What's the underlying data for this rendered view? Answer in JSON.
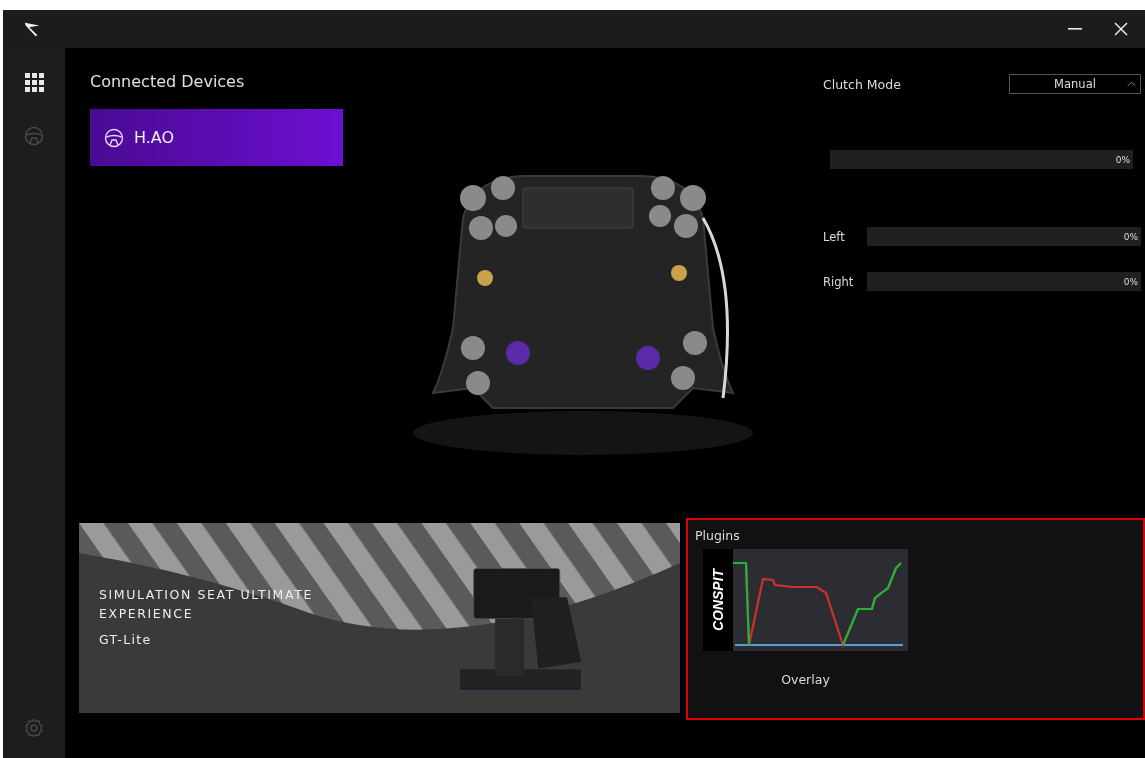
{
  "window": {
    "controls": [
      {
        "kind": "minimize"
      },
      {
        "kind": "close"
      }
    ]
  },
  "sidebar": {
    "items": [
      {
        "kind": "grid",
        "selected": true
      },
      {
        "kind": "wheel",
        "selected": false
      }
    ],
    "footer": {
      "kind": "settings"
    }
  },
  "devices": {
    "title": "Connected Devices",
    "items": [
      {
        "name": "H.AO",
        "selected": true
      }
    ]
  },
  "settings": {
    "clutch_mode": {
      "label": "Clutch Mode",
      "value": "Manual"
    },
    "meters": [
      {
        "level": 0,
        "reading": "0%"
      },
      {
        "label": "Left",
        "level": 0,
        "reading": "0%"
      },
      {
        "label": "Right",
        "level": 0,
        "reading": "0%"
      }
    ]
  },
  "banner": {
    "headline": "SIMULATION SEAT  ULTIMATE EXPERIENCE",
    "product": "GT-Lite"
  },
  "plugins": {
    "title": "Plugins",
    "highlighted": true,
    "items": [
      {
        "name": "Overlay",
        "logo_text": "CONSPIT"
      }
    ]
  }
}
